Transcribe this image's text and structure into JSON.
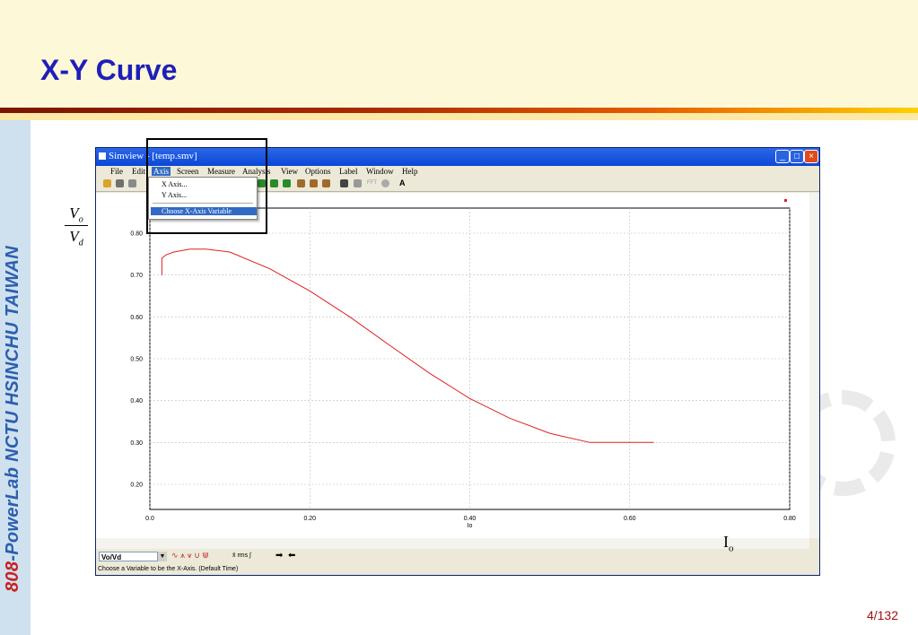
{
  "slide": {
    "title": "X-Y Curve",
    "sidebar_label_number": "808",
    "sidebar_label_rest": "-PowerLab NCTU HSINCHU TAIWAN",
    "page_number": "4/132",
    "ratio_numerator": "V",
    "ratio_numerator_sub": "o",
    "ratio_denominator": "V",
    "ratio_denominator_sub": "d",
    "x_annotation": "I",
    "x_annotation_sub": "o"
  },
  "window": {
    "title": "Simview - [temp.smv]",
    "menu": [
      "File",
      "Edit",
      "Axis",
      "Screen",
      "Measure",
      "Analysis",
      "View",
      "Options",
      "Label",
      "Window",
      "Help"
    ],
    "active_menu": "Axis",
    "dropdown": [
      "X Axis...",
      "Y Axis...",
      "Choose X-Axis Variable"
    ],
    "selected_dropdown": "Choose X-Axis Variable",
    "toolbar_text": {
      "fft": "FFT",
      "a": "A"
    },
    "variable": "Vo/Vd",
    "bottom_tools": "x̄  rms  ∫",
    "status": "Choose a Variable to be the X-Axis. (Default Time)"
  },
  "chart_data": {
    "type": "line",
    "title": "",
    "xlabel": "Io",
    "ylabel": "",
    "xlim": [
      0.0,
      0.8
    ],
    "ylim": [
      0.14,
      0.86
    ],
    "xticks": [
      "0.0",
      "0.20",
      "0.40",
      "0.60",
      "0.80"
    ],
    "yticks": [
      "0.20",
      "0.30",
      "0.40",
      "0.50",
      "0.60",
      "0.70",
      "0.80"
    ],
    "grid": true,
    "series": [
      {
        "color": "#e02020",
        "x": [
          0.015,
          0.015,
          0.015,
          0.02,
          0.03,
          0.05,
          0.07,
          0.1,
          0.15,
          0.2,
          0.25,
          0.3,
          0.35,
          0.4,
          0.45,
          0.5,
          0.55,
          0.6,
          0.63
        ],
        "y": [
          0.7,
          0.735,
          0.74,
          0.748,
          0.755,
          0.762,
          0.762,
          0.755,
          0.715,
          0.662,
          0.6,
          0.532,
          0.465,
          0.405,
          0.358,
          0.322,
          0.3,
          0.3,
          0.3
        ]
      }
    ]
  }
}
